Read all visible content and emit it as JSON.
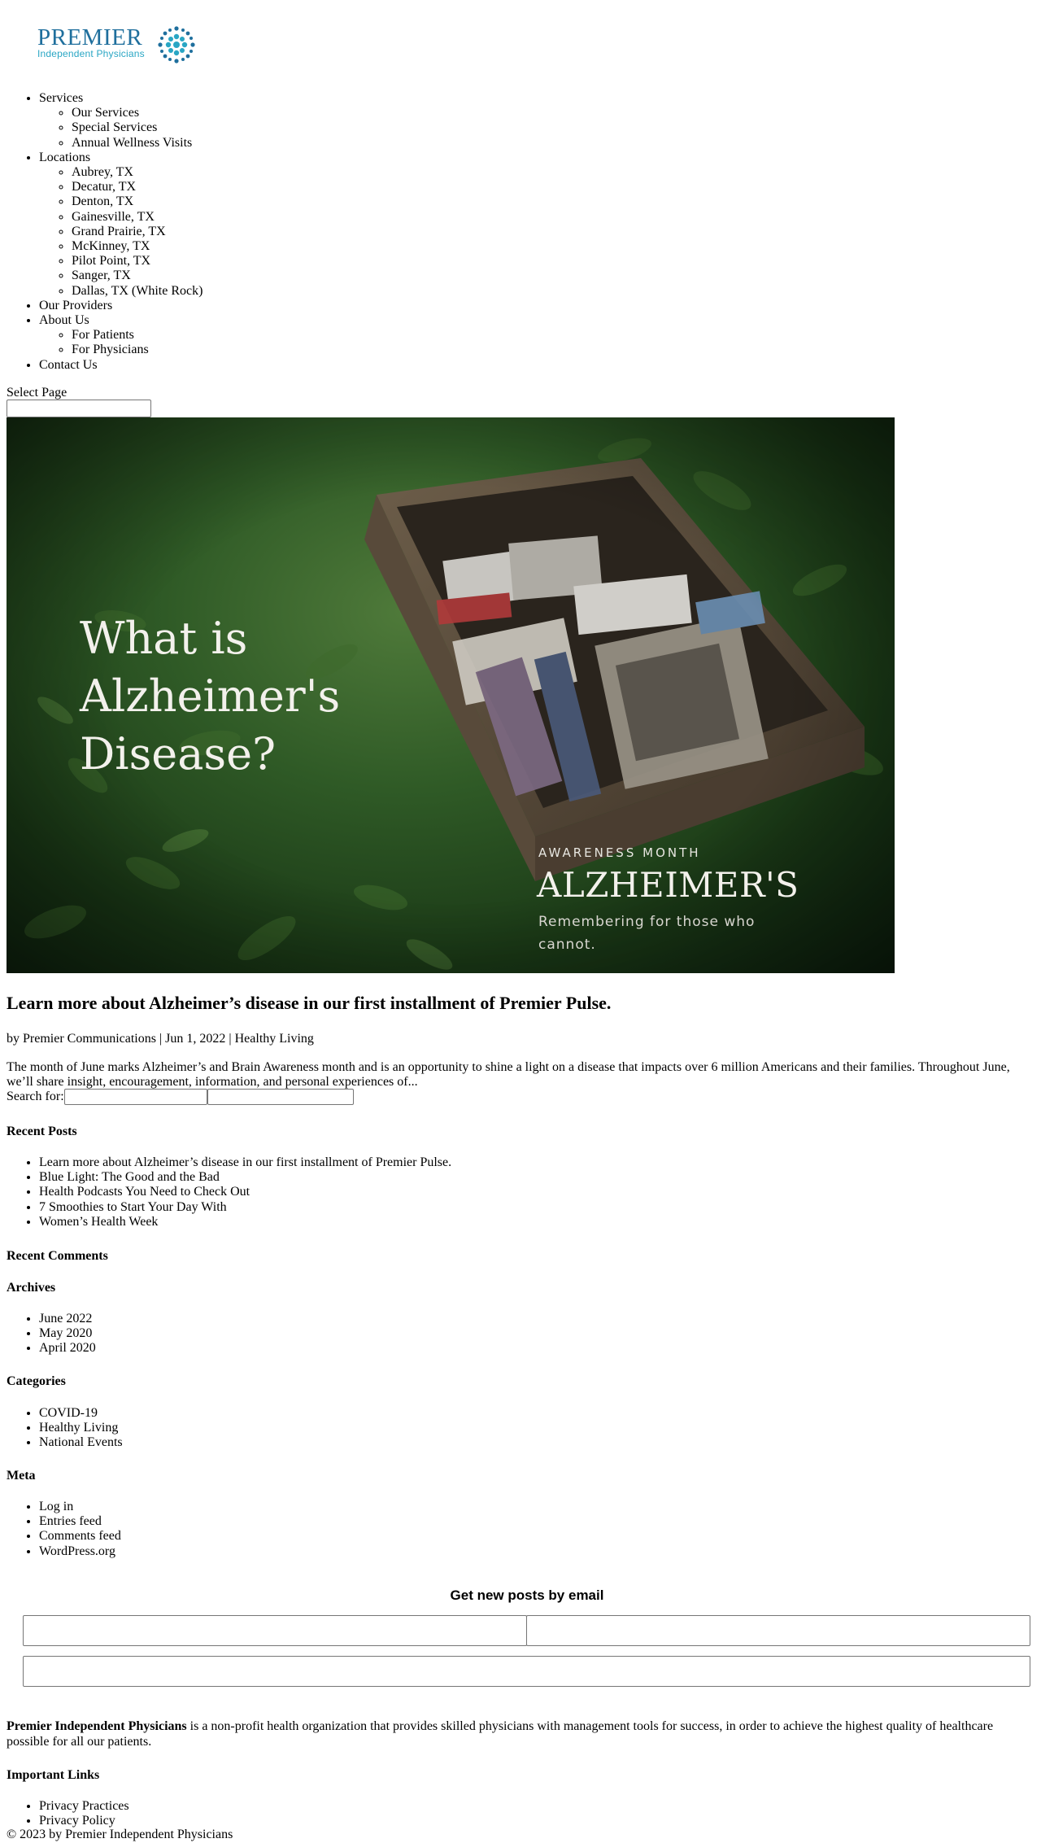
{
  "brand": {
    "name": "PREMIER",
    "tagline": "Independent Physicians",
    "colors": {
      "primary": "#1f6f9d",
      "accent": "#29a6c4"
    }
  },
  "nav": {
    "services": {
      "label": "Services",
      "items": [
        "Our Services",
        "Special Services",
        "Annual Wellness Visits"
      ]
    },
    "locations": {
      "label": "Locations",
      "items": [
        "Aubrey, TX",
        "Decatur, TX",
        "Denton, TX",
        "Gainesville, TX",
        "Grand Prairie, TX",
        "McKinney, TX",
        "Pilot Point, TX",
        "Sanger, TX",
        "Dallas, TX (White Rock)"
      ]
    },
    "providers": {
      "label": "Our Providers"
    },
    "about": {
      "label": "About Us",
      "items": [
        "For Patients",
        "For Physicians"
      ]
    },
    "contact": {
      "label": "Contact Us"
    },
    "select_page": "Select Page"
  },
  "hero": {
    "title_lines": [
      "What is",
      "Alzheimer's",
      "Disease?"
    ],
    "awareness_label": "AWARENESS MONTH",
    "awareness_big": "ALZHEIMER'S",
    "awareness_sub_lines": [
      "Remembering for those who",
      "cannot."
    ]
  },
  "post": {
    "title": "Learn more about Alzheimer’s disease in our first installment of Premier Pulse.",
    "meta": "by Premier Communications | Jun 1, 2022 | Healthy Living",
    "excerpt": "The month of June marks Alzheimer’s and Brain Awareness month and is an opportunity to shine a light on a disease that impacts over 6 million Americans and their families.  Throughout June, we’ll share insight, encouragement, information, and personal experiences of..."
  },
  "search": {
    "label": "Search for:"
  },
  "sidebar": {
    "recent_posts": {
      "title": "Recent Posts",
      "items": [
        "Learn more about Alzheimer’s disease in our first installment of Premier Pulse.",
        "Blue Light: The Good and the Bad",
        "Health Podcasts You Need to Check Out",
        "7 Smoothies to Start Your Day With",
        "Women’s Health Week"
      ]
    },
    "recent_comments": {
      "title": "Recent Comments"
    },
    "archives": {
      "title": "Archives",
      "items": [
        "June 2022",
        "May 2020",
        "April 2020"
      ]
    },
    "categories": {
      "title": "Categories",
      "items": [
        "COVID-19",
        "Healthy Living",
        "National Events"
      ]
    },
    "meta": {
      "title": "Meta",
      "items": [
        "Log in",
        "Entries feed",
        "Comments feed",
        "WordPress.org"
      ]
    }
  },
  "subscribe": {
    "title": "Get new posts by email"
  },
  "footer": {
    "org_name": "Premier Independent Physicians",
    "about_text": " is a non-profit health organization that provides skilled physicians with management tools for success, in order to achieve the highest quality of healthcare possible for all our patients.",
    "links_title": "Important Links",
    "links": [
      "Privacy Practices",
      "Privacy Policy"
    ],
    "copyright": "© 2023 by Premier Independent Physicians"
  }
}
